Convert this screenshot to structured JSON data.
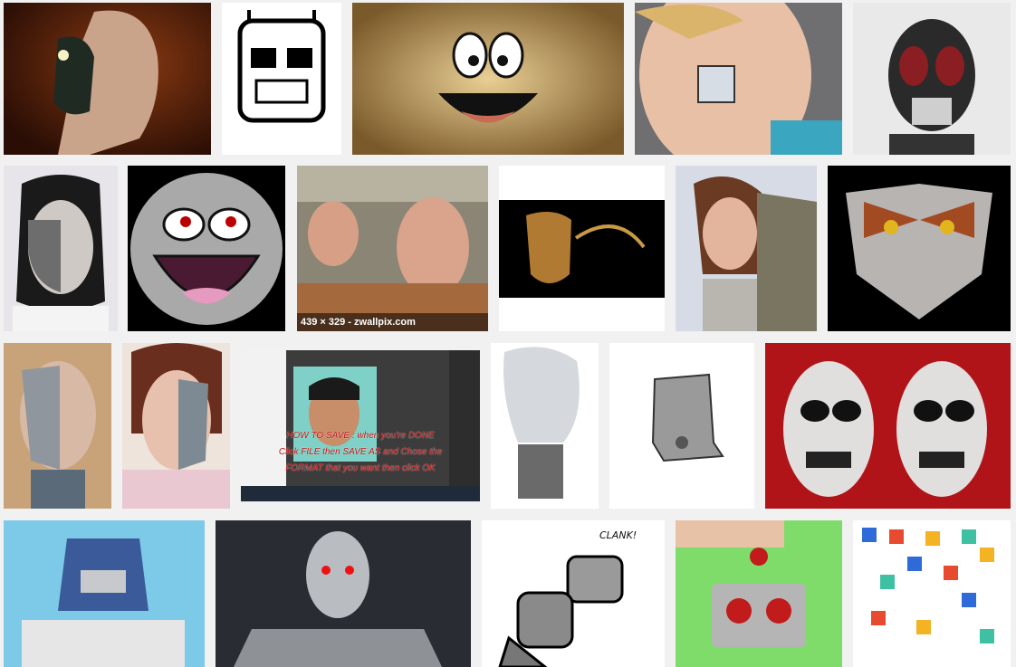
{
  "results": {
    "caption_zwallpix": "439 × 329 - zwallpix.com",
    "photoshop_overlay_line1": "HOW TO SAVE : when you're DONE",
    "photoshop_overlay_line2": "Click FILE then SAVE AS and Chose the",
    "photoshop_overlay_line3": "FORMAT that you want then click OK",
    "clank_text": "CLANK!"
  }
}
